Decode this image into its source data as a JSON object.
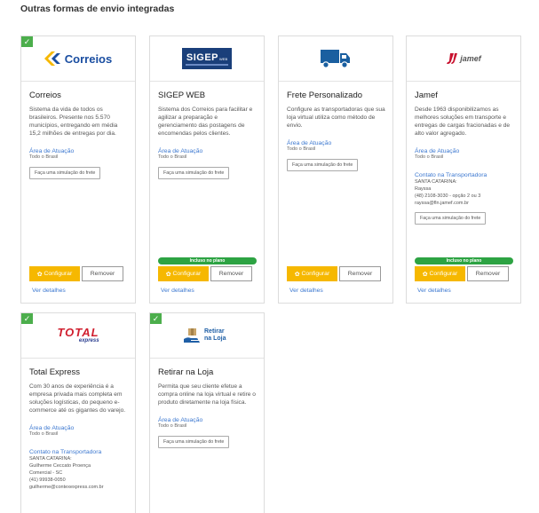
{
  "page": {
    "title": "Outras formas de envio integradas"
  },
  "common": {
    "configure_label": "Configurar",
    "remove_label": "Remover",
    "details_label": "Ver detalhes",
    "area_label": "Área de Atuação",
    "area_value": "Todo o Brasil",
    "simulate_label": "Faça uma simulação do frete",
    "contact_label": "Contato na Transportadora",
    "plan_badge": "Incluso no plano"
  },
  "cards": [
    {
      "name": "Correios",
      "logo_text": "Correios",
      "description": "Sistema da vida de todos os brasileiros. Presente nos 5.570 municípios, entregando em média 15,2 milhões de entregas por dia.",
      "checked": true
    },
    {
      "name": "SIGEP WEB",
      "logo_text": "SIGEP",
      "logo_sub": "WEB",
      "description": "Sistema dos Correios para facilitar e agilizar a preparação e gerenciamento das postagens de encomendas pelos clientes.",
      "checked": false
    },
    {
      "name": "Frete Personalizado",
      "description": "Configure as transportadoras que sua loja virtual utiliza como método de envio.",
      "checked": false
    },
    {
      "name": "Jamef",
      "logo_text": "jamef",
      "description": "Desde 1963 disponibilizamos as melhores soluções em transporte e entregas de cargas fracionadas e de alto valor agregado.",
      "checked": false,
      "contact": [
        "SANTA CATARINA:",
        "Rayssa",
        "(48) 2108-3030 - opção 2 ou 3",
        "rayssa@fln.jamef.com.br"
      ]
    },
    {
      "name": "Total Express",
      "logo_text": "TOTAL",
      "logo_sub": "express",
      "description": "Com 30 anos de experiência é a empresa privada mais completa em soluções logísticas, do pequeno e-commerce até os gigantes do varejo.",
      "checked": true,
      "contact": [
        "SANTA CATARINA:",
        "Guilherme Ceccato Proença",
        "Comercial - SC",
        "(41) 99938-0050",
        "guilherme@contexexpress.com.br"
      ]
    },
    {
      "name": "Retirar na Loja",
      "logo_text": "Retirar na Loja",
      "description": "Permita que seu cliente efetue a compra online na loja virtual e retire o produto diretamente na loja física.",
      "checked": true
    }
  ],
  "colors": {
    "config": "#f6b800",
    "link": "#3c78d0",
    "check": "#4cae4c",
    "badge": "#2da343"
  }
}
